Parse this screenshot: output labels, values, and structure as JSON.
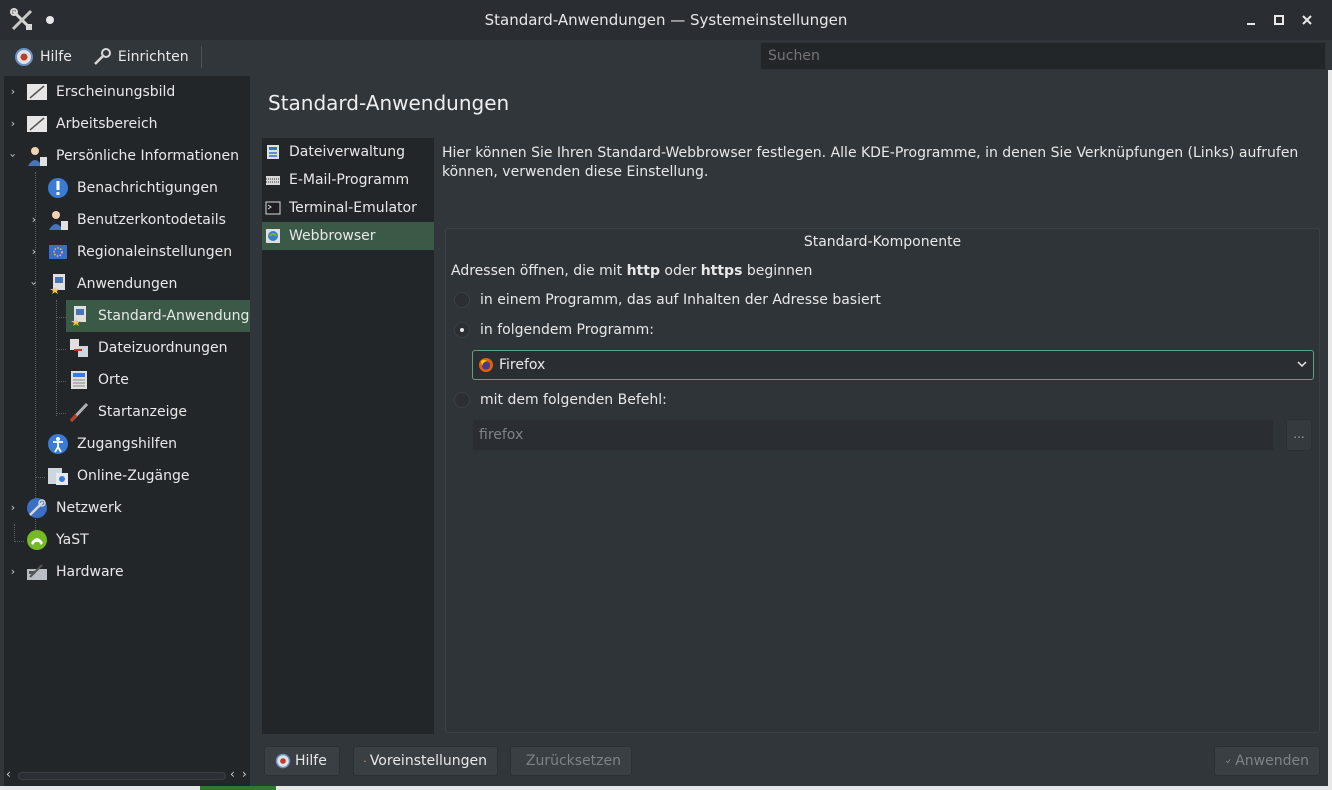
{
  "window": {
    "title": "Standard-Anwendungen — Systemeinstellungen",
    "controls": [
      "minimize-icon",
      "maximize-icon",
      "close-icon"
    ]
  },
  "toolbar": {
    "help_label": "Hilfe",
    "configure_label": "Einrichten",
    "search_placeholder": "Suchen"
  },
  "sidebar": {
    "items": [
      {
        "label": "Erscheinungsbild",
        "icon": "appearance-icon",
        "expanded": false
      },
      {
        "label": "Arbeitsbereich",
        "icon": "workspace-icon",
        "expanded": false
      },
      {
        "label": "Persönliche Informationen",
        "icon": "personal-info-icon",
        "expanded": true
      },
      {
        "label": "Benachrichtigungen",
        "icon": "notifications-icon"
      },
      {
        "label": "Benutzerkontodetails",
        "icon": "user-account-icon",
        "expanded": false
      },
      {
        "label": "Regionaleinstellungen",
        "icon": "regional-icon",
        "expanded": false
      },
      {
        "label": "Anwendungen",
        "icon": "applications-icon",
        "expanded": true
      },
      {
        "label": "Standard-Anwendungen",
        "icon": "default-apps-icon",
        "selected": true
      },
      {
        "label": "Dateizuordnungen",
        "icon": "file-associations-icon"
      },
      {
        "label": "Orte",
        "icon": "places-icon"
      },
      {
        "label": "Startanzeige",
        "icon": "launch-feedback-icon"
      },
      {
        "label": "Zugangshilfen",
        "icon": "accessibility-icon"
      },
      {
        "label": "Online-Zugänge",
        "icon": "online-accounts-icon"
      },
      {
        "label": "Netzwerk",
        "icon": "network-icon",
        "expanded": false
      },
      {
        "label": "YaST",
        "icon": "yast-icon"
      },
      {
        "label": "Hardware",
        "icon": "hardware-icon",
        "expanded": false
      }
    ]
  },
  "main": {
    "title": "Standard-Anwendungen",
    "categories": [
      {
        "label": "Dateiverwaltung",
        "icon": "file-manager-icon"
      },
      {
        "label": "E-Mail-Programm",
        "icon": "email-icon"
      },
      {
        "label": "Terminal-Emulator",
        "icon": "terminal-icon"
      },
      {
        "label": "Webbrowser",
        "icon": "web-browser-icon",
        "selected": true
      }
    ],
    "description": "Hier können Sie Ihren Standard-Webbrowser festlegen. Alle KDE-Programme, in denen Sie Verknüpfungen (Links) aufrufen können, verwenden diese Einstellung.",
    "group": {
      "title": "Standard-Komponente",
      "label_prefix": "Adressen öffnen, die mit ",
      "label_http": "http",
      "label_mid": " oder ",
      "label_https": "https",
      "label_suffix": " beginnen",
      "option_content": "in einem Programm, das auf Inhalten der Adresse basiert",
      "option_program": "in folgendem Programm:",
      "option_command": "mit dem folgenden Befehl:",
      "selected_option": "option_program",
      "program_value": "Firefox",
      "command_value": "firefox",
      "browse_label": "..."
    }
  },
  "buttons": {
    "help": "Hilfe",
    "defaults": "Voreinstellungen",
    "reset": "Zurücksetzen",
    "apply": "Anwenden"
  },
  "colors": {
    "accent": "#3b5947",
    "focus_border": "#5fa07e",
    "background": "#31363b",
    "panel": "#232629"
  }
}
